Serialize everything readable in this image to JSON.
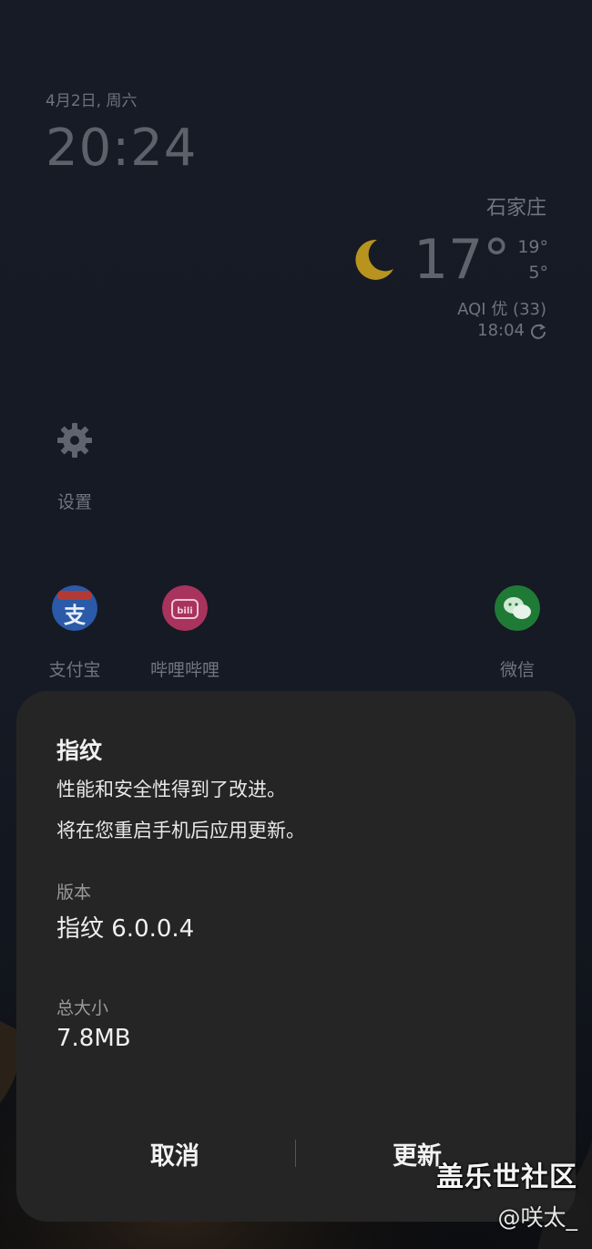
{
  "lockscreen": {
    "date": "4月2日, 周六",
    "time": "20:24"
  },
  "weather": {
    "city": "石家庄",
    "icon": "moon-icon",
    "temperature": "17°",
    "high": "19°",
    "low": "5°",
    "aqi": "AQI 优 (33)",
    "updated": "18:04"
  },
  "apps": [
    {
      "label": "设置",
      "icon": "gear-icon"
    },
    {
      "label": "支付宝",
      "icon": "alipay-icon"
    },
    {
      "label": "哔哩哔哩",
      "icon": "bilibili-icon"
    },
    {
      "label": "微信",
      "icon": "wechat-icon"
    }
  ],
  "dialog": {
    "title": "指纹",
    "line1": "性能和安全性得到了改进。",
    "line2": "将在您重启手机后应用更新。",
    "version_label": "版本",
    "version_value": "指纹 6.0.0.4",
    "size_label": "总大小",
    "size_value": "7.8MB",
    "cancel": "取消",
    "update": "更新"
  },
  "watermark": {
    "main": "盖乐世社区",
    "sub": "@咲太_"
  }
}
